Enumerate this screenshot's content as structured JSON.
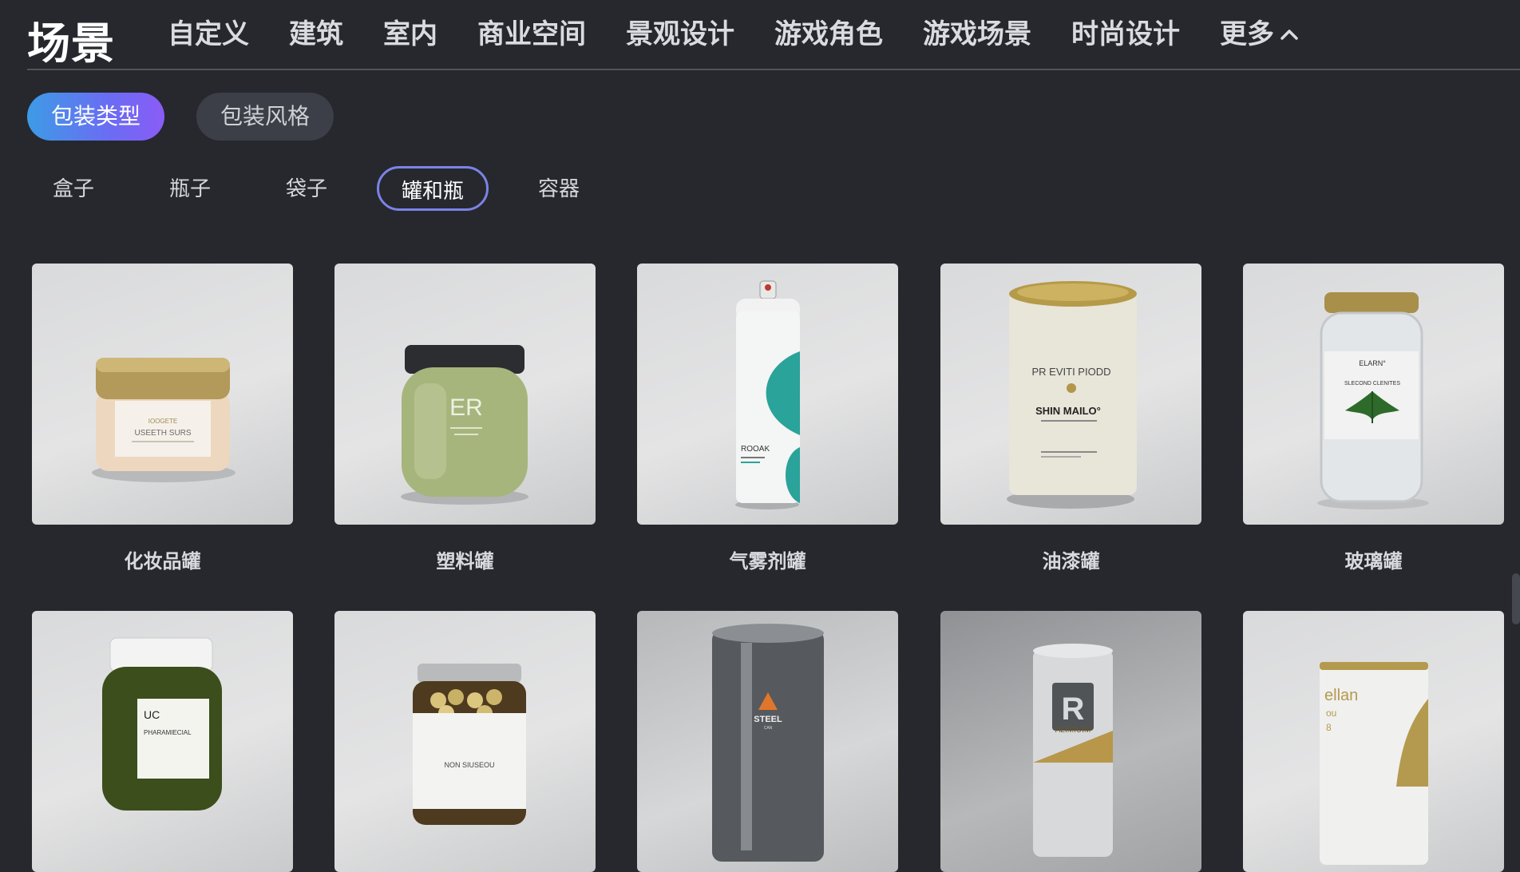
{
  "brand": "场景",
  "categories": [
    "自定义",
    "建筑",
    "室内",
    "商业空间",
    "景观设计",
    "游戏角色",
    "游戏场景",
    "时尚设计"
  ],
  "more_label": "更多",
  "pills": {
    "active": "包装类型",
    "inactive": "包装风格"
  },
  "subtabs": [
    "盒子",
    "瓶子",
    "袋子",
    "罐和瓶",
    "容器"
  ],
  "selected_subtab": "罐和瓶",
  "row1": [
    "化妆品罐",
    "塑料罐",
    "气雾剂罐",
    "油漆罐",
    "玻璃罐"
  ],
  "product_text": {
    "cosmetic": [
      "IOOGETE",
      "USEETH SURS"
    ],
    "plastic": [
      "ER"
    ],
    "aerosol": [
      "ROOAK"
    ],
    "paint": [
      "PR EVITI PIODD",
      "SHIN MAILO°"
    ],
    "glass": [
      "ELARN°",
      "SLECOND CLENITES"
    ],
    "green": [
      "UC",
      "PHARAMIECIAL"
    ],
    "pills": [
      "NON SIUSEOU"
    ],
    "steel": [
      "STEEL",
      "CAN"
    ],
    "aluminium": [
      "R",
      "ALIMIUIM"
    ],
    "tin": [
      "ellan",
      "ou",
      "8"
    ]
  },
  "colors": {
    "accent_start": "#3d9be6",
    "accent_end": "#8a5cf6",
    "selected_border": "#7b83e6",
    "bg": "#26282e"
  },
  "icons": {
    "more": "chevron-up-icon"
  }
}
